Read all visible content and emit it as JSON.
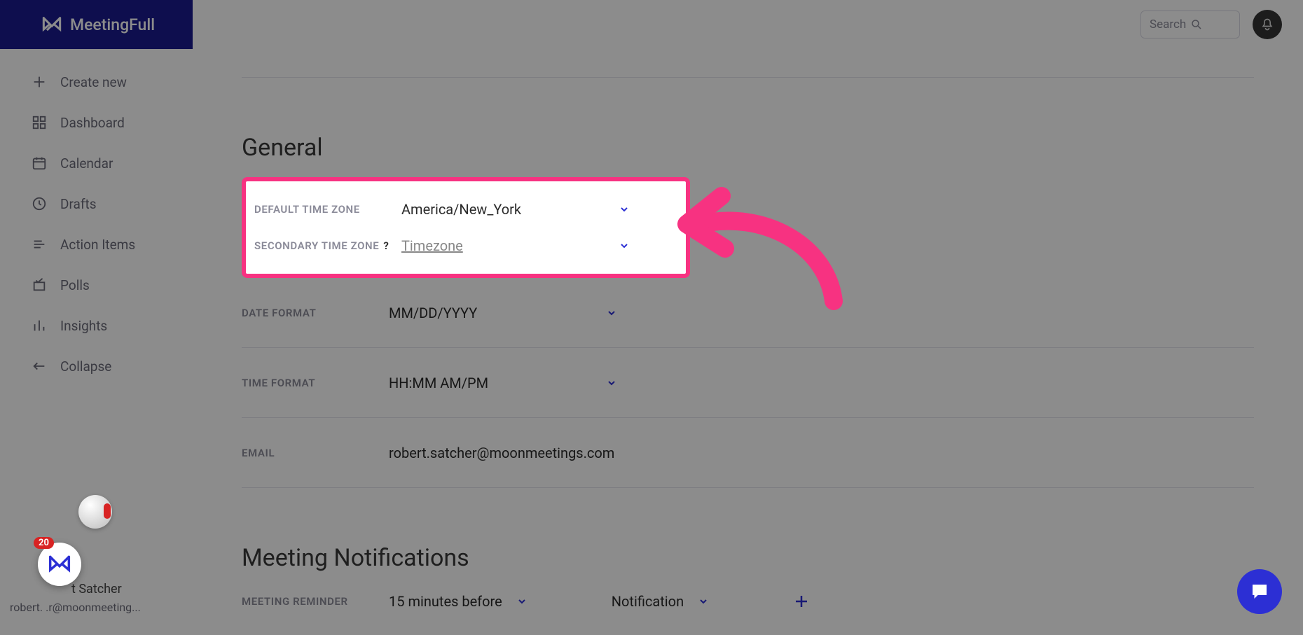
{
  "app_name": "MeetingFull",
  "topbar": {
    "search_placeholder": "Search",
    "badge_count": "20"
  },
  "sidebar": {
    "items": [
      {
        "label": "Create new"
      },
      {
        "label": "Dashboard"
      },
      {
        "label": "Calendar"
      },
      {
        "label": "Drafts"
      },
      {
        "label": "Action Items"
      },
      {
        "label": "Polls"
      },
      {
        "label": "Insights"
      },
      {
        "label": "Collapse"
      }
    ],
    "user_name": "t Satcher",
    "user_email": "robert.         .r@moonmeeting..."
  },
  "sections": {
    "general_title": "General",
    "notif_title": "Meeting Notifications"
  },
  "settings": {
    "default_tz_label": "DEFAULT TIME ZONE",
    "default_tz_value": "America/New_York",
    "secondary_tz_label": "SECONDARY TIME ZONE",
    "secondary_tz_placeholder": "Timezone",
    "date_format_label": "DATE FORMAT",
    "date_format_value": "MM/DD/YYYY",
    "time_format_label": "TIME FORMAT",
    "time_format_value": "HH:MM AM/PM",
    "email_label": "EMAIL",
    "email_value": "robert.satcher@moonmeetings.com",
    "reminder_label": "MEETING REMINDER",
    "reminder_time_value": "15 minutes before",
    "reminder_type_value": "Notification",
    "help_glyph": "?"
  }
}
